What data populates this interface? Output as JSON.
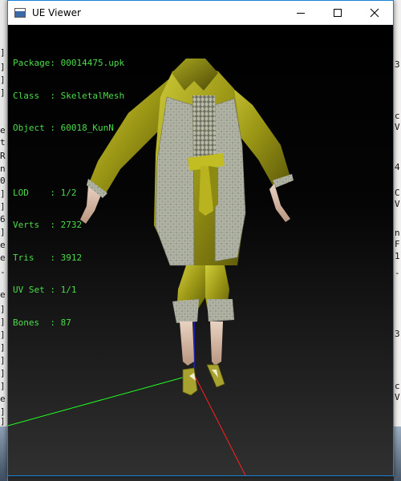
{
  "window": {
    "title": "UE Viewer",
    "icon": "app-window-icon",
    "controls": [
      "minimize",
      "maximize",
      "close"
    ]
  },
  "info": {
    "rows": [
      {
        "key": "Package",
        "value": "00014475.upk"
      },
      {
        "key": "Class  ",
        "value": "SkeletalMesh"
      },
      {
        "key": "Object ",
        "value": "60018_KunN"
      },
      {
        "key": "LOD    ",
        "value": "1/2"
      },
      {
        "key": "Verts  ",
        "value": "2732"
      },
      {
        "key": "Tris   ",
        "value": "3912"
      },
      {
        "key": "UV Set ",
        "value": "1/1"
      },
      {
        "key": "Bones  ",
        "value": "87"
      }
    ]
  },
  "colors": {
    "label_green": "#4bdc4b",
    "value_white": "#ffffff",
    "axis_x": "#ff2020",
    "axis_y": "#20ff20",
    "axis_z": "#2020ff",
    "cloth_yellow": "#a9a61a",
    "cloth_shadow": "#5a5708",
    "weave_grey": "#b5b8a8"
  },
  "background_window": {
    "left_chars": [
      "]",
      "]",
      "]",
      "]",
      "e",
      "t",
      "R",
      "n",
      "0",
      "]",
      "]",
      "6",
      "]",
      "e",
      "e",
      "-",
      "e",
      "]",
      "]",
      "]",
      "]",
      "]",
      "]",
      "]",
      "e",
      "]",
      "]"
    ],
    "right_chars": [
      "3",
      "c",
      "V",
      "4",
      "C",
      "V",
      "n",
      "F",
      "1",
      "-",
      "3",
      "c",
      "V"
    ]
  }
}
